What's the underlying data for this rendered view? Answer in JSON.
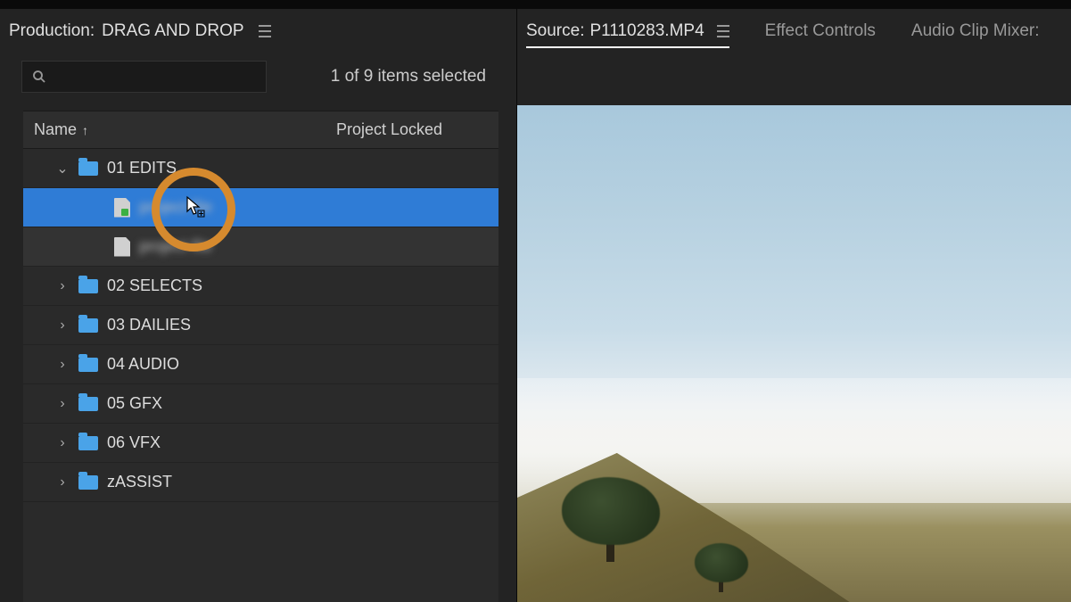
{
  "leftPanel": {
    "tabLabel": "Production:",
    "tabValue": "DRAG AND DROP",
    "selectionCount": "1 of 9 items selected",
    "columns": {
      "name": "Name",
      "locked": "Project Locked"
    },
    "bins": [
      {
        "label": "01 EDITS",
        "expanded": true,
        "type": "folder",
        "indent": 1
      },
      {
        "label": "project file",
        "expanded": null,
        "type": "file-green",
        "indent": 2,
        "selected": true,
        "blur": true
      },
      {
        "label": "project file",
        "expanded": null,
        "type": "file",
        "indent": 2,
        "dim": true,
        "blur": true
      },
      {
        "label": "02 SELECTS",
        "expanded": false,
        "type": "folder",
        "indent": 1
      },
      {
        "label": "03 DAILIES",
        "expanded": false,
        "type": "folder",
        "indent": 1
      },
      {
        "label": "04 AUDIO",
        "expanded": false,
        "type": "folder",
        "indent": 1
      },
      {
        "label": "05 GFX",
        "expanded": false,
        "type": "folder",
        "indent": 1
      },
      {
        "label": "06 VFX",
        "expanded": false,
        "type": "folder",
        "indent": 1
      },
      {
        "label": "zASSIST",
        "expanded": false,
        "type": "folder",
        "indent": 1
      }
    ]
  },
  "rightPanel": {
    "sourceLabel": "Source:",
    "sourceValue": "P1110283.MP4",
    "tabs": {
      "effectControls": "Effect Controls",
      "audioClipMixer": "Audio Clip Mixer:"
    }
  }
}
